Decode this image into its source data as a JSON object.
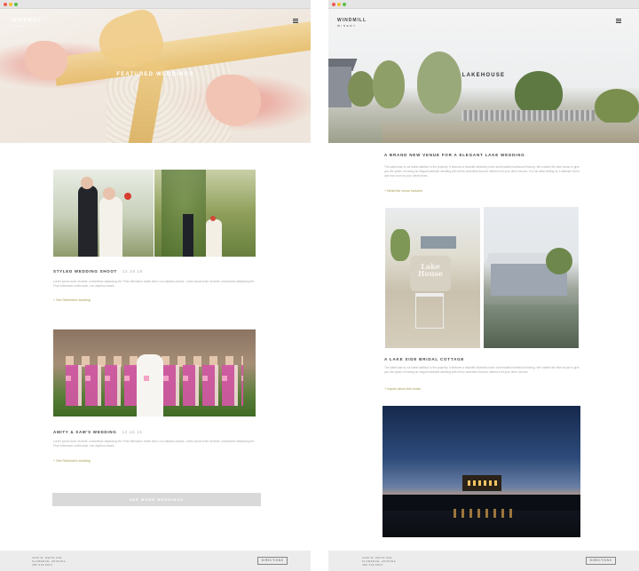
{
  "left_page": {
    "logo": "WINDMILL",
    "logo_sub": "WINERY",
    "hero_title": "FEATURED WEDDINGS",
    "posts": [
      {
        "title": "STYLED WEDDING SHOOT",
        "date": "12.16.15",
        "body": "Lorem ipsum dolor sit amet, consectetur adipiscing elit. Proin bibendum mollis dolor, non dapibus mauris. Lorem ipsum dolor sit amet, consectetur adipiscing elit. Proin bibendum mollis dolor, non dapibus mauris.",
        "link": "+ See Rebekah's wedding"
      },
      {
        "title": "AMITY & SAM'S WEDDING",
        "date": "12.16.15",
        "body": "Lorem ipsum dolor sit amet, consectetur adipiscing elit. Proin bibendum mollis dolor, non dapibus mauris. Lorem ipsum dolor sit amet, consectetur adipiscing elit. Proin bibendum mollis dolor, non dapibus mauris.",
        "link": "+ See Rebekah's wedding"
      }
    ],
    "cta_label": "SEE MORE WEDDINGS",
    "footer": {
      "address_line1": "2240 W. DEITZ AVE",
      "address_line2": "FLORENCE, ARIZONA",
      "address_line3": "480.318.6913",
      "button_label": "DIRECTIONS"
    }
  },
  "right_page": {
    "logo": "WINDMILL",
    "logo_sub": "WINERY",
    "hero_title": "LAKEHOUSE",
    "sections": [
      {
        "title": "A BRAND NEW VENUE FOR A ELEGANT LAKE WEDDING",
        "body": "The lakehouse is our latest addition to the property. It features a beautiful lakeside porch and beautiful hardwood flooring. We created the lake house to give you the option of having an elegant lakeside wedding with all the amenities that are offered to fit your other venues. It is the ideal setting for a lakeside event and has room for your whole team.",
        "link": "+ What this venue includes"
      },
      {
        "title": "A LAKE SIDE BRIDAL COTTAGE",
        "body": "The lakehouse is our latest addition to the property. It features a beautiful lakeside porch and beautiful hardwood flooring. We created the lake house to give you the option of having an elegant lakeside wedding with all the amenities that are offered to fit your other venues.",
        "link": "+ Inquire about this rental"
      }
    ],
    "sign_text": "Lake House",
    "footer": {
      "address_line1": "2240 W. DEITZ AVE",
      "address_line2": "FLORENCE, ARIZONA",
      "address_line3": "480.318.6913",
      "button_label": "DIRECTIONS"
    }
  },
  "colors": {
    "accent": "#a39a4a",
    "footer_bg": "#ececec",
    "cta_bg": "#d9d9d9"
  },
  "icons": [
    "menu-icon"
  ]
}
